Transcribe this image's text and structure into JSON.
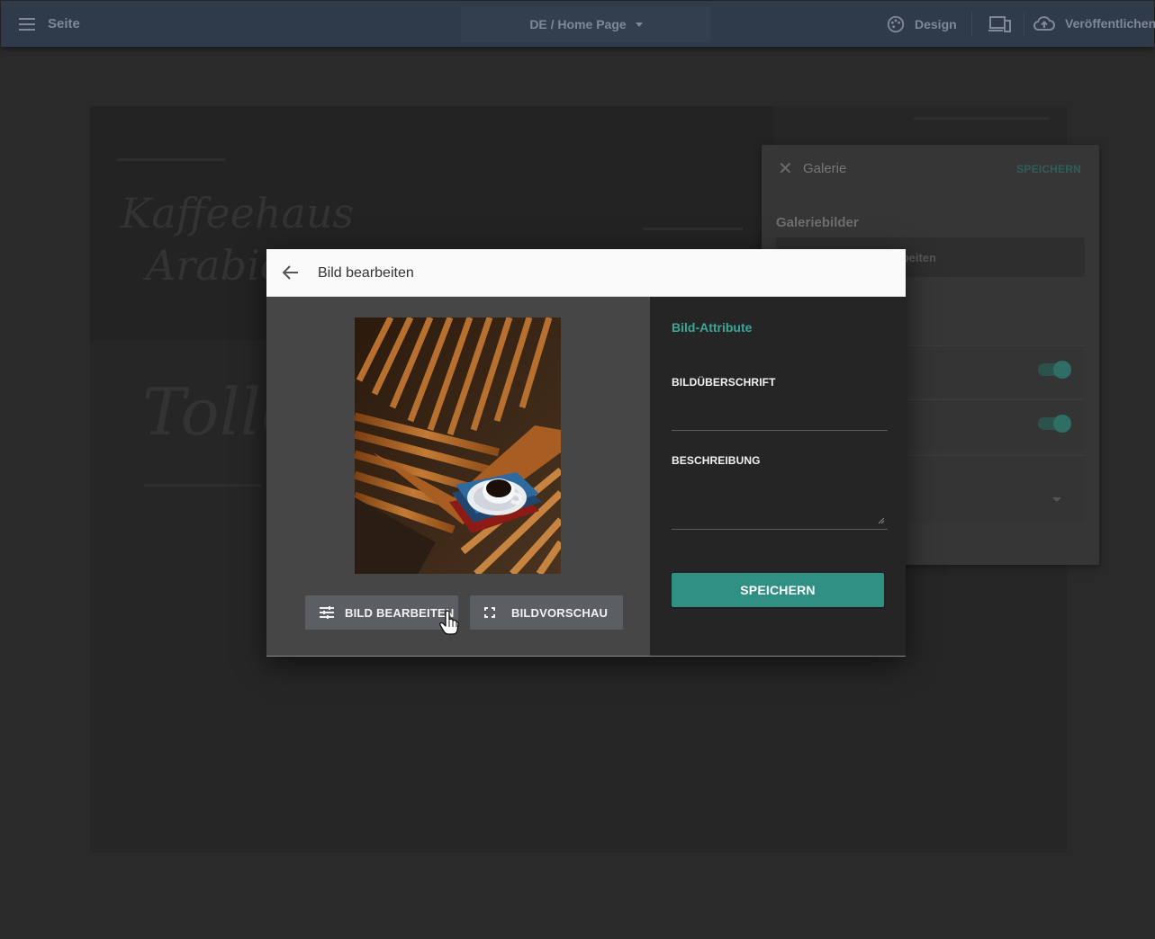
{
  "topbar": {
    "menu_label": "Seite",
    "page_select": "DE / Home Page",
    "design_label": "Design",
    "publish_label": "Veröffentlichen"
  },
  "background_page": {
    "script_title_line1": "Kaffeehaus",
    "script_title_line2": "Arabica",
    "script_heading": "Tolle"
  },
  "gallery_panel": {
    "title": "Galerie",
    "save_label": "SPEICHERN",
    "section_label": "Galeriebilder",
    "edit_button": "r bearbeiten",
    "toggle1_on": true,
    "toggle2_on": true
  },
  "modal": {
    "title": "Bild bearbeiten",
    "edit_image_button": "BILD BEARBEITEN",
    "preview_button": "BILDVORSCHAU",
    "attributes_title": "Bild-Attribute",
    "caption_label": "BILDÜBERSCHRIFT",
    "caption_value": "",
    "description_label": "BESCHREIBUNG",
    "description_value": "",
    "save_button": "SPEICHERN"
  },
  "colors": {
    "accent": "#2f9083",
    "accent_text": "#3aa898",
    "topbar": "#2f3a4b"
  },
  "icons": {
    "menu": "hamburger-icon",
    "design": "palette-icon",
    "devices": "devices-icon",
    "publish": "cloud-upload-icon",
    "back": "arrow-left-icon",
    "edit": "tune-icon",
    "preview": "fullscreen-icon"
  }
}
